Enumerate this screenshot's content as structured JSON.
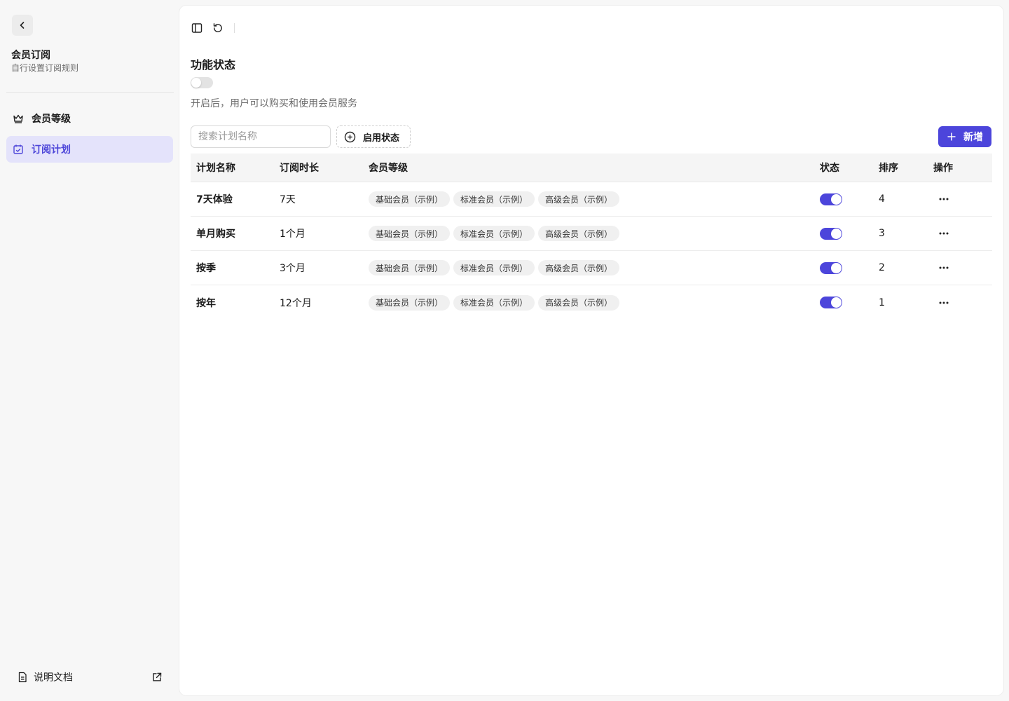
{
  "sidebar": {
    "title": "会员订阅",
    "subtitle": "自行设置订阅规则",
    "items": [
      {
        "label": "会员等级",
        "icon": "crown-icon"
      },
      {
        "label": "订阅计划",
        "icon": "calendar-check-icon",
        "active": true
      }
    ],
    "docs_label": "说明文档"
  },
  "feature": {
    "title": "功能状态",
    "enabled": false,
    "description": "开启后，用户可以购买和使用会员服务"
  },
  "toolbar": {
    "search_placeholder": "搜索计划名称",
    "filter_label": "启用状态",
    "add_label": "新增"
  },
  "table": {
    "headers": {
      "name": "计划名称",
      "duration": "订阅时长",
      "levels": "会员等级",
      "status": "状态",
      "order": "排序",
      "ops": "操作"
    },
    "rows": [
      {
        "name": "7天体验",
        "duration": "7天",
        "levels": [
          "基础会员（示例）",
          "标准会员（示例）",
          "高级会员（示例）"
        ],
        "enabled": true,
        "order": "4"
      },
      {
        "name": "单月购买",
        "duration": "1个月",
        "levels": [
          "基础会员（示例）",
          "标准会员（示例）",
          "高级会员（示例）"
        ],
        "enabled": true,
        "order": "3"
      },
      {
        "name": "按季",
        "duration": "3个月",
        "levels": [
          "基础会员（示例）",
          "标准会员（示例）",
          "高级会员（示例）"
        ],
        "enabled": true,
        "order": "2"
      },
      {
        "name": "按年",
        "duration": "12个月",
        "levels": [
          "基础会员（示例）",
          "标准会员（示例）",
          "高级会员（示例）"
        ],
        "enabled": true,
        "order": "1"
      }
    ]
  },
  "colors": {
    "accent": "#4c45db",
    "active_nav_bg": "#e4e3fb",
    "tag_bg": "#f0f0f0"
  }
}
